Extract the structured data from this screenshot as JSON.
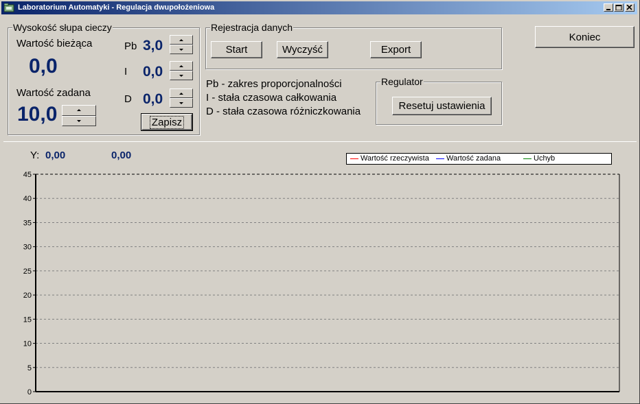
{
  "window": {
    "title": "Laboratorium Automatyki - Regulacja dwupołożeniowa"
  },
  "level_group": {
    "title": "Wysokość słupa cieczy",
    "current_label": "Wartość bieżąca",
    "current_value": "0,0",
    "setpoint_label": "Wartość zadana",
    "setpoint_value": "10,0",
    "pb_label": "Pb",
    "pb_value": "3,0",
    "i_label": "I",
    "i_value": "0,0",
    "d_label": "D",
    "d_value": "0,0",
    "save_label": "Zapisz"
  },
  "registration": {
    "title": "Rejestracja danych",
    "start_label": "Start",
    "clear_label": "Wyczyść",
    "export_label": "Export"
  },
  "exit_label": "Koniec",
  "legend_text": {
    "pb": "Pb - zakres proporcjonalności",
    "i": "I - stała czasowa całkowania",
    "d": "D - stała czasowa różniczkowania"
  },
  "regulator": {
    "title": "Regulator",
    "reset_label": "Resetuj ustawienia"
  },
  "readout": {
    "y_label": "Y:",
    "value1": "0,00",
    "value2": "0,00"
  },
  "colors": {
    "accent_value": "#0a246a",
    "series_actual": "#ff0000",
    "series_setpoint": "#0000ff",
    "series_error": "#008000"
  },
  "chart_data": {
    "type": "line",
    "series": [
      {
        "name": "Wartość rzeczywista",
        "color": "#ff0000",
        "values": []
      },
      {
        "name": "Wartość zadana",
        "color": "#0000ff",
        "values": []
      },
      {
        "name": "Uchyb",
        "color": "#008000",
        "values": []
      }
    ],
    "ylim": [
      0,
      45
    ],
    "yticks": [
      "0",
      "5",
      "10",
      "15",
      "20",
      "25",
      "30",
      "35",
      "40",
      "45"
    ],
    "grid": true,
    "legend_position": "top-right"
  }
}
